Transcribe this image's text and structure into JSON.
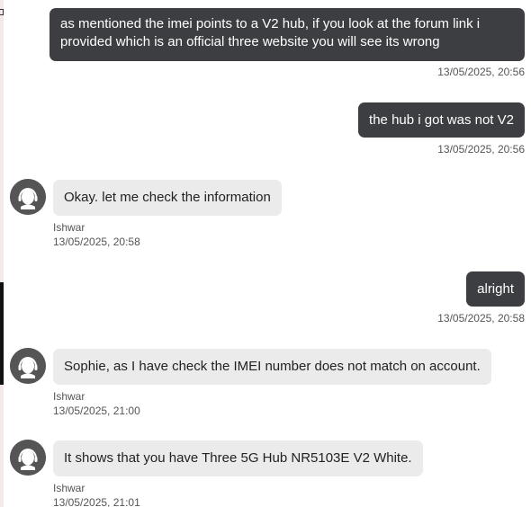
{
  "messages": [
    {
      "type": "sent",
      "text": "as mentioned the imei points to a V2 hub, if you look at the forum link i provided which is an official three website you will see its wrong",
      "time": "13/05/2025, 20:56"
    },
    {
      "type": "sent",
      "text": "the hub i got was not V2",
      "time": "13/05/2025, 20:56"
    },
    {
      "type": "received",
      "text": "Okay. let me check the information",
      "author": "Ishwar",
      "time": "13/05/2025, 20:58",
      "avatar_icon": "agent-headset-icon"
    },
    {
      "type": "sent",
      "text": "alright",
      "time": "13/05/2025, 20:58"
    },
    {
      "type": "received",
      "text": "Sophie, as I have check the IMEI number does not match on account.",
      "author": "Ishwar",
      "time": "13/05/2025, 21:00",
      "avatar_icon": "agent-headset-icon"
    },
    {
      "type": "received",
      "text": "It shows that you have Three 5G Hub NR5103E V2 White.",
      "author": "Ishwar",
      "time": "13/05/2025, 21:01",
      "avatar_icon": "agent-headset-icon"
    }
  ],
  "colors": {
    "sent_bubble": "#3c3e42",
    "received_bubble": "#ebebeb",
    "avatar_bg": "#555555"
  }
}
